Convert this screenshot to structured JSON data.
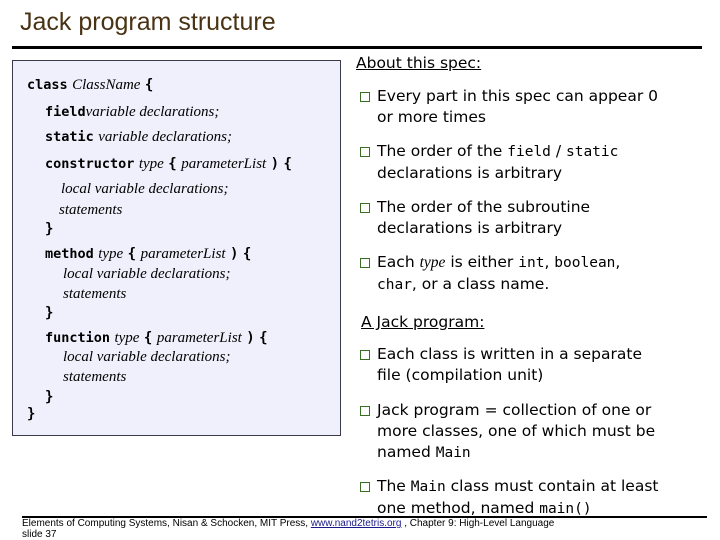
{
  "title": "Jack program structure",
  "code": {
    "line1": {
      "kw": "class",
      "it": "ClassName",
      "br": "{"
    },
    "field": {
      "kw": "field",
      "it": "variable declarations;"
    },
    "static": {
      "kw": "static",
      "it": "variable declarations;"
    },
    "constructor": {
      "kw": "constructor",
      "it1": "type",
      "br1": "{",
      "it2": "parameterList",
      "br2": ")",
      "br3": "{"
    },
    "constructor_body": {
      "locals": "local variable declarations;",
      "statements": "statements",
      "close": "}"
    },
    "method": {
      "kw": "method",
      "it1": "type",
      "br1": "{",
      "it2": "parameterList",
      "br2": ")",
      "br3": "{"
    },
    "method_body": {
      "locals": "local variable declarations;",
      "statements": "statements",
      "close": "}"
    },
    "function": {
      "kw": "function",
      "it1": "type",
      "br1": "{",
      "it2": "parameterList",
      "br2": ")",
      "br3": "{"
    },
    "function_body": {
      "locals": "local variable declarations;",
      "statements": "statements",
      "close": "}"
    },
    "class_close": "}"
  },
  "about": {
    "heading": "About this spec:",
    "bullets": [
      {
        "line1": "Every part in this spec can appear 0",
        "line2": "or more times"
      },
      {
        "pre": "The order of the ",
        "code1": "field",
        "mid": " / ",
        "code2": "static",
        "line2": "declarations is arbitrary"
      },
      {
        "line1": "The order of the subroutine",
        "line2": "declarations is arbitrary"
      },
      {
        "pre": "Each ",
        "it": "type",
        "mid": " is either ",
        "code1": "int",
        "sep": ", ",
        "code2": "boolean",
        "end": ",",
        "code3": "char",
        "line2_rest": ", or a class name."
      }
    ]
  },
  "program": {
    "heading": "A Jack program:",
    "bullets": [
      {
        "line1": "Each class is written in a separate",
        "line2": "file (compilation unit)"
      },
      {
        "line1": "Jack program = collection of one or",
        "line2": "more classes, one of which must be",
        "line3_pre": "named ",
        "line3_code": "Main"
      },
      {
        "pre": "The ",
        "code1": "Main",
        "post": " class must contain at least",
        "line2_pre": "one method, named ",
        "line2_code": "main()"
      }
    ]
  },
  "footer": {
    "text1": "Elements of Computing Systems, Nisan & Schocken, MIT Press,  ",
    "link": "www.nand2tetris.org",
    "text2": " , Chapter 9: High-Level Language",
    "slide": "slide 37"
  }
}
